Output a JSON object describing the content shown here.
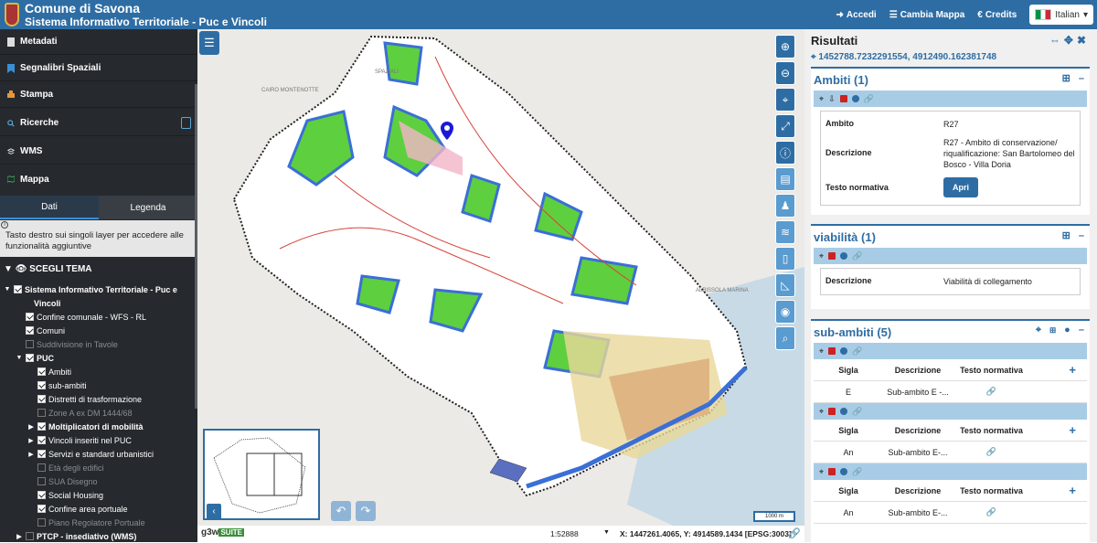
{
  "header": {
    "title": "Comune di Savona",
    "subtitle": "Sistema Informativo Territoriale - Puc e Vincoli",
    "nav": [
      {
        "label": "Accedi",
        "icon": "sign-in-icon"
      },
      {
        "label": "Cambia Mappa",
        "icon": "map-switch-icon"
      },
      {
        "label": "Credits",
        "icon": "euro-icon"
      }
    ],
    "language": "Italian"
  },
  "sidebar": {
    "items": [
      {
        "label": "Metadati",
        "icon": "document-icon",
        "color": "#dddddd"
      },
      {
        "label": "Segnalibri Spaziali",
        "icon": "bookmark-icon",
        "color": "#3a8fd6"
      },
      {
        "label": "Stampa",
        "icon": "print-icon",
        "color": "#e8953a"
      },
      {
        "label": "Ricerche",
        "icon": "search-icon",
        "color": "#5aa7d8"
      },
      {
        "label": "WMS",
        "icon": "layers-icon",
        "color": "#dddddd"
      },
      {
        "label": "Mappa",
        "icon": "map-icon",
        "color": "#3aa65a"
      }
    ],
    "tabs": [
      "Dati",
      "Legenda"
    ],
    "info_text": "Tasto destro sui singoli layer per accedere alle funzionalità aggiuntive",
    "theme_label": "SCEGLI TEMA",
    "tree": [
      {
        "label": "Sistema Informativo Territoriale - Puc e",
        "level": 0,
        "checked": true,
        "caret": "▼",
        "bold": true
      },
      {
        "label": "Vincoli",
        "level": 0,
        "checked": null,
        "caret": "",
        "bold": true,
        "cont": true
      },
      {
        "label": "Confine comunale - WFS - RL",
        "level": 1,
        "checked": true
      },
      {
        "label": "Comuni",
        "level": 1,
        "checked": true
      },
      {
        "label": "Suddivisione in Tavole",
        "level": 1,
        "checked": false,
        "dim": true
      },
      {
        "label": "PUC",
        "level": 1,
        "checked": true,
        "caret": "▼",
        "bold": true
      },
      {
        "label": "Ambiti",
        "level": 2,
        "checked": true
      },
      {
        "label": "sub-ambiti",
        "level": 2,
        "checked": true
      },
      {
        "label": "Distretti di trasformazione",
        "level": 2,
        "checked": true
      },
      {
        "label": "Zone A ex DM 1444/68",
        "level": 2,
        "checked": false,
        "dim": true
      },
      {
        "label": "Moltiplicatori di mobilità",
        "level": 2,
        "checked": true,
        "caret": "▶",
        "bold": true
      },
      {
        "label": "Vincoli inseriti nel PUC",
        "level": 2,
        "checked": true,
        "caret": "▶"
      },
      {
        "label": "Servizi e standard urbanistici",
        "level": 2,
        "checked": true,
        "caret": "▶"
      },
      {
        "label": "Età degli edifici",
        "level": 2,
        "checked": false,
        "dim": true
      },
      {
        "label": "SUA Disegno",
        "level": 2,
        "checked": false,
        "dim": true
      },
      {
        "label": "Social Housing",
        "level": 2,
        "checked": true
      },
      {
        "label": "Confine area portuale",
        "level": 2,
        "checked": true
      },
      {
        "label": "Piano Regolatore Portuale",
        "level": 2,
        "checked": false,
        "dim": true
      },
      {
        "label": "PTCP - insediativo (WMS)",
        "level": 1,
        "checked": false,
        "caret": "▶",
        "bold": true
      }
    ]
  },
  "map": {
    "place_labels": [
      "CAIRO MONTENOTTE",
      "SPAZIALI",
      "ALBISSOLA MARINA"
    ],
    "scale": "1:52888",
    "scalebar_label": "1000 m",
    "coordinates": "X: 1447261.4065, Y: 4914589.1434",
    "epsg": "[EPSG:3003]",
    "brand": "g3w",
    "brand_suffix": "SUITE",
    "tools": [
      "zoom-in-icon",
      "zoom-out-icon",
      "zoom-extent-icon",
      "fullscreen-icon",
      "info-icon",
      "query-icon",
      "street-view-icon",
      "add-layer-icon",
      "split-icon",
      "measure-icon",
      "screenshot-icon",
      "geolocation-icon"
    ]
  },
  "results": {
    "title": "Risultati",
    "coords": "1452788.7232291554, 4912490.162381748",
    "ambiti": {
      "title": "Ambiti (1)",
      "rows": [
        {
          "key": "Ambito",
          "value": "R27"
        },
        {
          "key": "Descrizione",
          "value": "R27 - Ambito di conservazione/ riqualificazione: San Bartolomeo del Bosco - Villa Doria"
        },
        {
          "key": "Testo normativa",
          "value": ""
        }
      ],
      "button": "Apri"
    },
    "viabilita": {
      "title": "viabilità (1)",
      "rows": [
        {
          "key": "Descrizione",
          "value": "Viabilità di collegamento"
        }
      ]
    },
    "subambiti": {
      "title": "sub-ambiti (5)",
      "headers": [
        "Sigla",
        "Descrizione",
        "Testo normativa"
      ],
      "blocks": [
        {
          "sigla": "E",
          "descr": "Sub-ambito E -..."
        },
        {
          "sigla": "An",
          "descr": "Sub-ambito E-..."
        },
        {
          "sigla": "An",
          "descr": "Sub-ambito E-..."
        }
      ]
    }
  }
}
